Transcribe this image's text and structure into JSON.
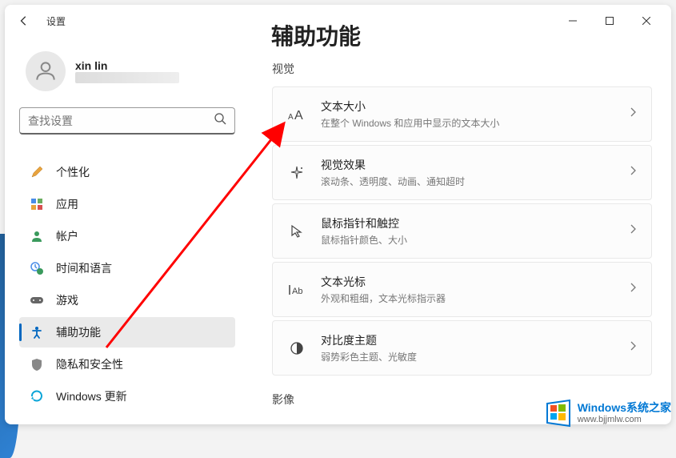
{
  "app_title": "设置",
  "page_title": "辅助功能",
  "user": {
    "name": "xin lin"
  },
  "search": {
    "placeholder": "查找设置"
  },
  "nav": [
    {
      "label": "个性化",
      "icon": "paintbrush"
    },
    {
      "label": "应用",
      "icon": "apps"
    },
    {
      "label": "帐户",
      "icon": "person"
    },
    {
      "label": "时间和语言",
      "icon": "clock-globe"
    },
    {
      "label": "游戏",
      "icon": "gamepad"
    },
    {
      "label": "辅助功能",
      "icon": "accessibility",
      "active": true
    },
    {
      "label": "隐私和安全性",
      "icon": "shield"
    },
    {
      "label": "Windows 更新",
      "icon": "update"
    }
  ],
  "sections": {
    "vision_label": "视觉",
    "video_label": "影像"
  },
  "cards": [
    {
      "title": "文本大小",
      "sub": "在整个 Windows 和应用中显示的文本大小",
      "icon": "text-size"
    },
    {
      "title": "视觉效果",
      "sub": "滚动条、透明度、动画、通知超时",
      "icon": "sparkle"
    },
    {
      "title": "鼠标指针和触控",
      "sub": "鼠标指针颜色、大小",
      "icon": "cursor"
    },
    {
      "title": "文本光标",
      "sub": "外观和粗细，文本光标指示器",
      "icon": "text-cursor"
    },
    {
      "title": "对比度主题",
      "sub": "弱势彩色主题、光敏度",
      "icon": "contrast"
    }
  ],
  "watermark": {
    "title": "Windows系统之家",
    "url": "www.bjjmlw.com"
  }
}
